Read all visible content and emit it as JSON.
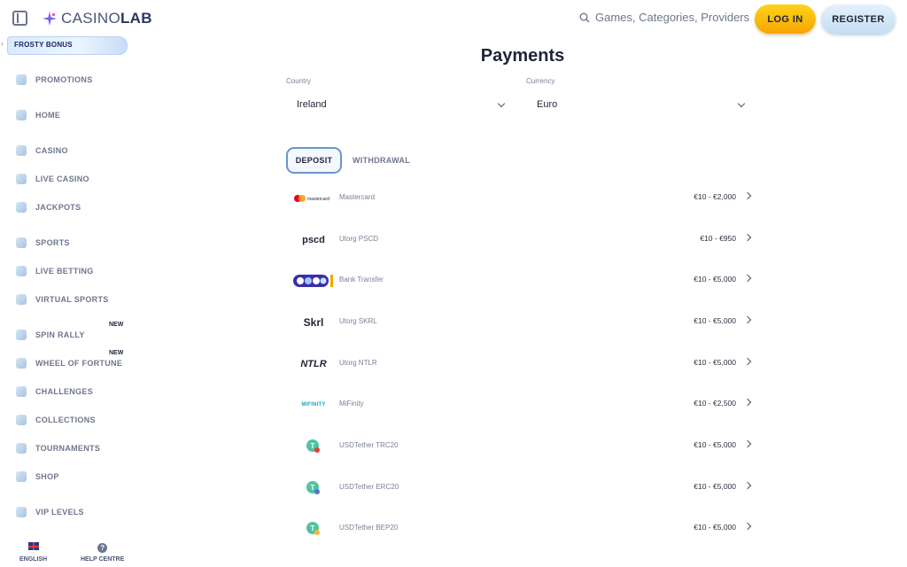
{
  "header": {
    "logo_prefix": "CASINO",
    "logo_suffix": "LAB",
    "search_placeholder": "Games, Categories, Providers",
    "login_label": "LOG IN",
    "register_label": "REGISTER"
  },
  "sidebar": {
    "promo_banner": "FROSTY BONUS",
    "items": [
      {
        "label": "PROMOTIONS",
        "icon": "megaphone-icon"
      },
      {
        "label": "HOME",
        "icon": "home-icon"
      },
      {
        "label": "CASINO",
        "icon": "casino-chip-icon"
      },
      {
        "label": "LIVE CASINO",
        "icon": "live-casino-icon"
      },
      {
        "label": "JACKPOTS",
        "icon": "jackpot-icon"
      },
      {
        "label": "SPORTS",
        "icon": "sports-icon"
      },
      {
        "label": "LIVE BETTING",
        "icon": "live-betting-icon"
      },
      {
        "label": "VIRTUAL SPORTS",
        "icon": "virtual-sports-icon"
      },
      {
        "label": "SPIN RALLY",
        "icon": "spin-rally-icon"
      },
      {
        "label": "WHEEL OF FORTUNE",
        "icon": "wheel-icon"
      },
      {
        "label": "CHALLENGES",
        "icon": "challenges-icon"
      },
      {
        "label": "COLLECTIONS",
        "icon": "collections-icon"
      },
      {
        "label": "TOURNAMENTS",
        "icon": "trophy-icon"
      },
      {
        "label": "SHOP",
        "icon": "shop-icon"
      },
      {
        "label": "VIP LEVELS",
        "icon": "vip-icon"
      }
    ],
    "new_badge": "NEW",
    "language_label": "ENGLISH",
    "help_label": "HELP CENTRE"
  },
  "main": {
    "title": "Payments",
    "country_label": "Country",
    "country_value": "Ireland",
    "currency_label": "Currency",
    "currency_value": "Euro",
    "tabs": [
      "DEPOSIT",
      "WITHDRAWAL"
    ],
    "methods": [
      {
        "name": "Mastercard",
        "range": "€10 - €2,000",
        "logo_text": "mastercard"
      },
      {
        "name": "Utorg PSCD",
        "range": "€10 - €950",
        "logo_text": "pscd"
      },
      {
        "name": "Bank Transfer",
        "range": "€10 - €5,000",
        "logo_text": ""
      },
      {
        "name": "Utorg SKRL",
        "range": "€10 - €5,000",
        "logo_text": "Skrl"
      },
      {
        "name": "Utorg NTLR",
        "range": "€10 - €5,000",
        "logo_text": "NTLR"
      },
      {
        "name": "MiFinity",
        "range": "€10 - €2,500",
        "logo_text": "MIFINITY"
      },
      {
        "name": "USDTether TRC20",
        "range": "€10 - €5,000",
        "logo_text": ""
      },
      {
        "name": "USDTether ERC20",
        "range": "€10 - €5,000",
        "logo_text": ""
      },
      {
        "name": "USDTether BEP20",
        "range": "€10 - €5,000",
        "logo_text": ""
      }
    ]
  },
  "colors": {
    "accent_yellow": "#f5a500",
    "accent_blue": "#6a95cc",
    "text_dark": "#1f2438"
  }
}
